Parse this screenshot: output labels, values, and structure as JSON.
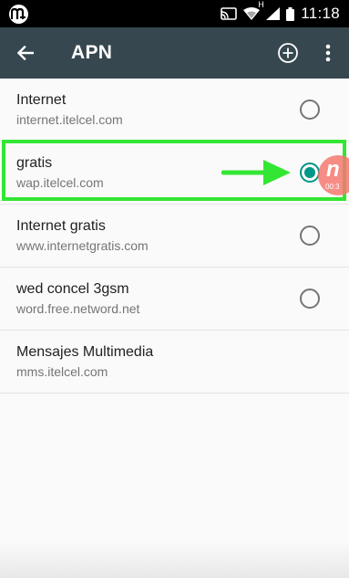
{
  "status_bar": {
    "time": "11:18",
    "network_letter": "H",
    "icons": [
      "app-badge-icon",
      "cast-icon",
      "wifi-icon",
      "signal-icon",
      "battery-icon"
    ]
  },
  "toolbar": {
    "title": "APN",
    "back_icon": "arrow-back-icon",
    "add_icon": "add-circle-icon",
    "more_icon": "more-vert-icon"
  },
  "apns": [
    {
      "name": "Internet",
      "apn": "internet.itelcel.com",
      "has_radio": true,
      "selected": false
    },
    {
      "name": "gratis",
      "apn": "wap.itelcel.com",
      "has_radio": true,
      "selected": true
    },
    {
      "name": "Internet gratis",
      "apn": "www.internetgratis.com",
      "has_radio": true,
      "selected": false
    },
    {
      "name": "wed concel 3gsm",
      "apn": "word.free.netword.net",
      "has_radio": true,
      "selected": false
    },
    {
      "name": "Mensajes Multimedia",
      "apn": "mms.itelcel.com",
      "has_radio": false,
      "selected": false
    }
  ],
  "annotation": {
    "highlight_color": "#33e633",
    "arrow_color": "#33e633"
  },
  "watermark": {
    "mark": "n",
    "time": "00:3"
  },
  "colors": {
    "toolbar": "#37474f",
    "status_bar": "#000000",
    "accent": "#009688"
  }
}
